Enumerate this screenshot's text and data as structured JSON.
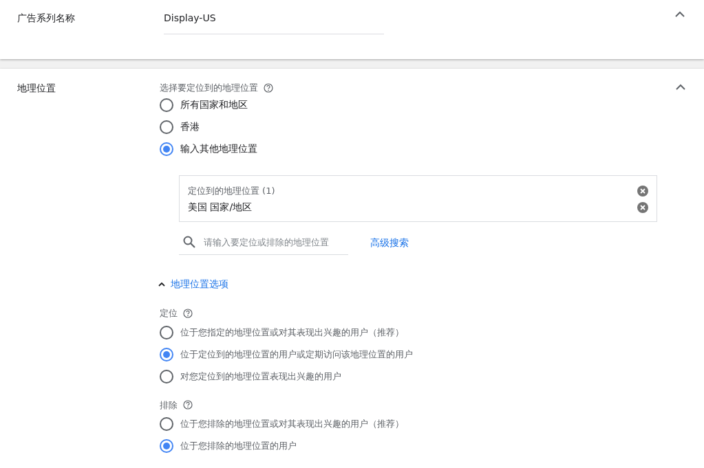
{
  "campaign_name": {
    "label": "广告系列名称",
    "value": "Display-US",
    "expanded": true
  },
  "location": {
    "label": "地理位置",
    "expanded": true,
    "prompt": "选择要定位到的地理位置",
    "options": [
      {
        "label": "所有国家和地区",
        "selected": false
      },
      {
        "label": "香港",
        "selected": false
      },
      {
        "label": "输入其他地理位置",
        "selected": true
      }
    ],
    "targeted": {
      "title": "定位到的地理位置 (1)",
      "items": [
        "美国 国家/地区"
      ]
    },
    "search": {
      "placeholder": "请输入要定位或排除的地理位置"
    },
    "advanced_link": "高级搜索",
    "options_toggle": {
      "label": "地理位置选项",
      "expanded": true
    },
    "groups": [
      {
        "title": "定位",
        "options": [
          {
            "label": "位于您指定的地理位置或对其表现出兴趣的用户（推荐）",
            "selected": false
          },
          {
            "label": "位于定位到的地理位置的用户或定期访问该地理位置的用户",
            "selected": true
          },
          {
            "label": "对您定位到的地理位置表现出兴趣的用户",
            "selected": false
          }
        ]
      },
      {
        "title": "排除",
        "options": [
          {
            "label": "位于您排除的地理位置或对其表现出兴趣的用户（推荐）",
            "selected": false
          },
          {
            "label": "位于您排除的地理位置的用户",
            "selected": true
          }
        ]
      }
    ]
  }
}
